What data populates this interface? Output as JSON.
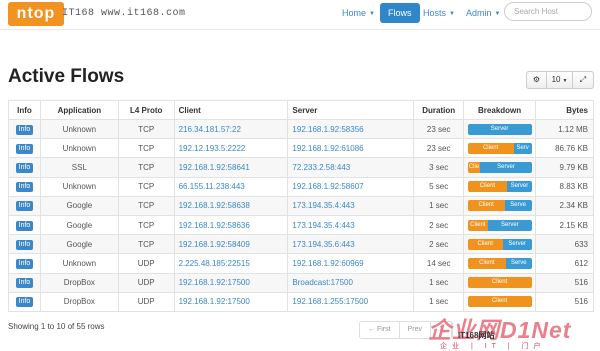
{
  "navbar": {
    "logo_text": "ntop",
    "watermark_url": "IT168 www.it168.com",
    "items": [
      {
        "label": "Home",
        "dropdown": true
      },
      {
        "label": "Flows",
        "dropdown": false,
        "active": true
      },
      {
        "label": "Hosts",
        "dropdown": true
      },
      {
        "label": "Admin",
        "dropdown": true
      }
    ],
    "search_placeholder": "Search Host"
  },
  "page": {
    "title": "Active Flows",
    "toolbar": {
      "settings_icon": "gear-icon",
      "page_size": "10",
      "expand_icon": "expand-icon"
    }
  },
  "table": {
    "columns": [
      "Info",
      "Application",
      "L4 Proto",
      "Client",
      "Server",
      "Duration",
      "Breakdown",
      "Bytes"
    ],
    "rows": [
      {
        "info": "Info",
        "application": "Unknown",
        "proto": "TCP",
        "client": "216.34.181.57:22",
        "server": "192.168.1.92:58356",
        "duration": "23 sec",
        "client_pct": 0,
        "server_label": "Server",
        "client_label": "",
        "bytes": "1.12 MB"
      },
      {
        "info": "Info",
        "application": "Unknown",
        "proto": "TCP",
        "client": "192.12.193.5:2222",
        "server": "192.168.1.92:61086",
        "duration": "23 sec",
        "client_pct": 72,
        "server_label": "Serv",
        "client_label": "Client",
        "bytes": "86.76 KB"
      },
      {
        "info": "Info",
        "application": "SSL",
        "proto": "TCP",
        "client": "192.168.1.92:58641",
        "server": "72.233.2.58:443",
        "duration": "3 sec",
        "client_pct": 20,
        "server_label": "Server",
        "client_label": "Clie",
        "bytes": "9.79 KB"
      },
      {
        "info": "Info",
        "application": "Unknown",
        "proto": "TCP",
        "client": "66.155.11.238:443",
        "server": "192.168.1.92:58607",
        "duration": "5 sec",
        "client_pct": 62,
        "server_label": "Server",
        "client_label": "Client",
        "bytes": "8.83 KB"
      },
      {
        "info": "Info",
        "application": "Google",
        "proto": "TCP",
        "client": "192.168.1.92:58638",
        "server": "173.194.35.4:443",
        "duration": "1 sec",
        "client_pct": 58,
        "server_label": "Serve",
        "client_label": "Client",
        "bytes": "2.34 KB"
      },
      {
        "info": "Info",
        "application": "Google",
        "proto": "TCP",
        "client": "192.168.1.92:58636",
        "server": "173.194.35.4:443",
        "duration": "2 sec",
        "client_pct": 32,
        "server_label": "Server",
        "client_label": "Client",
        "bytes": "2.15 KB"
      },
      {
        "info": "Info",
        "application": "Google",
        "proto": "TCP",
        "client": "192.168.1.92:58409",
        "server": "173.194.35.6:443",
        "duration": "2 sec",
        "client_pct": 55,
        "server_label": "Server",
        "client_label": "Client",
        "bytes": "633"
      },
      {
        "info": "Info",
        "application": "Unknown",
        "proto": "UDP",
        "client": "2.225.48.185:22515",
        "server": "192.168.1.92:60969",
        "duration": "14 sec",
        "client_pct": 60,
        "server_label": "Serve",
        "client_label": "Client",
        "bytes": "612"
      },
      {
        "info": "Info",
        "application": "DropBox",
        "proto": "UDP",
        "client": "192.168.1.92:17500",
        "server": "Broadcast:17500",
        "duration": "1 sec",
        "client_pct": 100,
        "server_label": "",
        "client_label": "Client",
        "bytes": "516"
      },
      {
        "info": "Info",
        "application": "DropBox",
        "proto": "UDP",
        "client": "192.168.1.92:17500",
        "server": "192.168.1.255:17500",
        "duration": "1 sec",
        "client_pct": 100,
        "server_label": "",
        "client_label": "Client",
        "bytes": "516"
      }
    ]
  },
  "footer": {
    "summary": "Showing 1 to 10 of 55 rows",
    "pager": [
      "← First",
      "Prev",
      "1"
    ]
  },
  "watermark": {
    "brand": "企业网D1Net",
    "site": "IT168网站",
    "slogan": "企业 | IT | 门户"
  },
  "colors": {
    "accent": "#3a87c9",
    "client": "#f0931e",
    "server": "#3a9bd4",
    "logo": "#f29221"
  }
}
